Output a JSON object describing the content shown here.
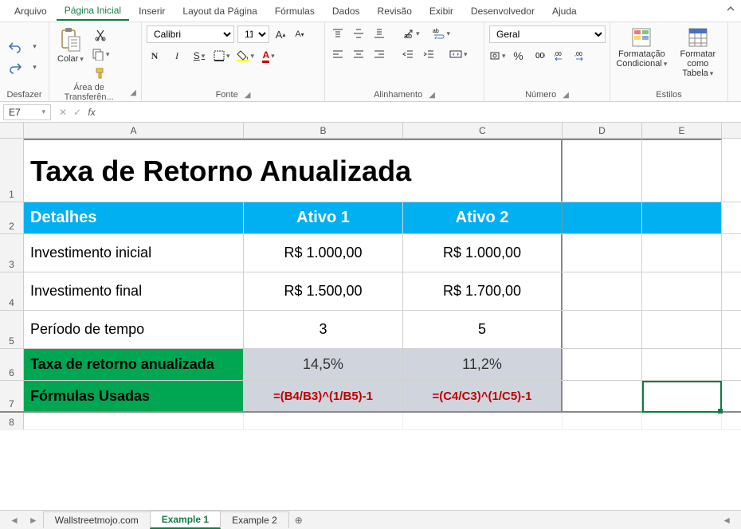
{
  "menu": [
    "Arquivo",
    "Página Inicial",
    "Inserir",
    "Layout da Página",
    "Fórmulas",
    "Dados",
    "Revisão",
    "Exibir",
    "Desenvolvedor",
    "Ajuda"
  ],
  "menu_active": 1,
  "ribbon": {
    "undo_group": "Desfazer",
    "clipboard_group": "Área de Transferên...",
    "paste_label": "Colar",
    "font_group": "Fonte",
    "font_name": "Calibri",
    "font_size": "11",
    "align_group": "Alinhamento",
    "number_group": "Número",
    "number_format": "Geral",
    "styles_group": "Estilos",
    "cond_format": "Formatação Condicional",
    "format_table": "Formatar como Tabela"
  },
  "namebox": "E7",
  "formula": "",
  "cols": [
    "A",
    "B",
    "C",
    "D",
    "E"
  ],
  "row_nums": [
    "1",
    "2",
    "3",
    "4",
    "5",
    "6",
    "7",
    "8"
  ],
  "sheet": {
    "title": "Taxa de Retorno Anualizada",
    "h_detalhes": "Detalhes",
    "h_ativo1": "Ativo 1",
    "h_ativo2": "Ativo 2",
    "r3a": "Investimento inicial",
    "r3b": "R$ 1.000,00",
    "r3c": "R$ 1.000,00",
    "r4a": "Investimento final",
    "r4b": "R$ 1.500,00",
    "r4c": "R$ 1.700,00",
    "r5a": "Período de tempo",
    "r5b": "3",
    "r5c": "5",
    "r6a": "Taxa de retorno anualizada",
    "r6b": "14,5%",
    "r6c": "11,2%",
    "r7a": "Fórmulas Usadas",
    "r7b": "=(B4/B3)^(1/B5)-1",
    "r7c": "=(C4/C3)^(1/C5)-1"
  },
  "tabs": [
    "Wallstreetmojo.com",
    "Example 1",
    "Example 2"
  ],
  "tab_active": 1
}
